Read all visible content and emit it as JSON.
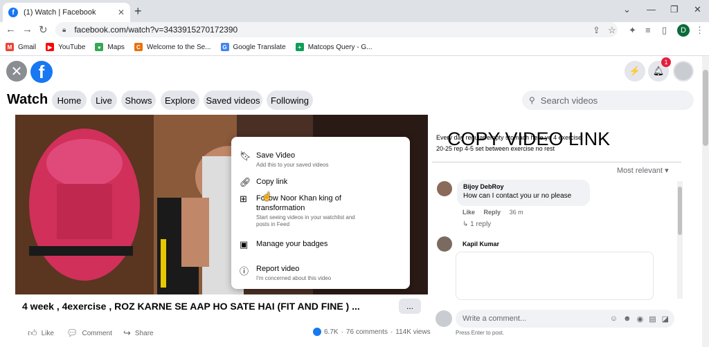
{
  "browser": {
    "tab_title": "(1) Watch | Facebook",
    "url": "facebook.com/watch?v=3433915270172390",
    "profile_initial": "D",
    "bookmarks": [
      {
        "label": "Gmail",
        "color": "#ea4335",
        "glyph": "M"
      },
      {
        "label": "YouTube",
        "color": "#ff0000",
        "glyph": "▶"
      },
      {
        "label": "Maps",
        "color": "#34a853",
        "glyph": "●"
      },
      {
        "label": "Welcome to the Se...",
        "color": "#e8710a",
        "glyph": "C"
      },
      {
        "label": "Google Translate",
        "color": "#4285f4",
        "glyph": "G"
      },
      {
        "label": "Matcops Query - G...",
        "color": "#0f9d58",
        "glyph": "+"
      }
    ]
  },
  "facebook": {
    "notification_count": "1",
    "watch_title": "Watch",
    "nav": [
      "Home",
      "Live",
      "Shows",
      "Explore",
      "Saved videos",
      "Following"
    ],
    "search_placeholder": "Search videos"
  },
  "context_menu": {
    "items": [
      {
        "title": "Save Video",
        "subtitle": "Add this to your saved videos",
        "icon": "bookmark-icon"
      },
      {
        "title": "Copy link",
        "subtitle": "",
        "icon": "link-icon"
      },
      {
        "title": "Follow Noor Khan king of transformation",
        "subtitle": "Start seeing videos in your watchlist and posts in Feed",
        "icon": "follow-icon"
      },
      {
        "title": "Manage your badges",
        "subtitle": "",
        "icon": "badge-icon"
      },
      {
        "title": "Report video",
        "subtitle": "I'm concerned about this video",
        "icon": "report-icon"
      }
    ]
  },
  "video": {
    "title": "4 week , 4exercise , ROZ KARNE SE AAP HO SATE HAI (FIT AND FINE ) ...",
    "more_label": "...",
    "actions": {
      "like": "Like",
      "comment": "Comment",
      "share": "Share"
    },
    "reactions": "6.7K",
    "comments_count": "76 comments",
    "views": "114K views"
  },
  "right_panel": {
    "overlay_caption": "COPY VIDEO LINK",
    "description_line1": "Every day regular empty stomach here ye 4 exercise",
    "description_line2": "20-25 rep 4-5 set between exercise no rest",
    "sort_label": "Most relevant",
    "comments": [
      {
        "name": "Bijoy DebRoy",
        "text": "How can I contact you ur no please",
        "like": "Like",
        "reply": "Reply",
        "time": "36 m",
        "replies": "1 reply"
      },
      {
        "name": "Kapil Kumar",
        "text": "",
        "like": "",
        "reply": "",
        "time": "",
        "replies": ""
      }
    ],
    "write_placeholder": "Write a comment...",
    "press_enter_hint": "Press Enter to post."
  }
}
